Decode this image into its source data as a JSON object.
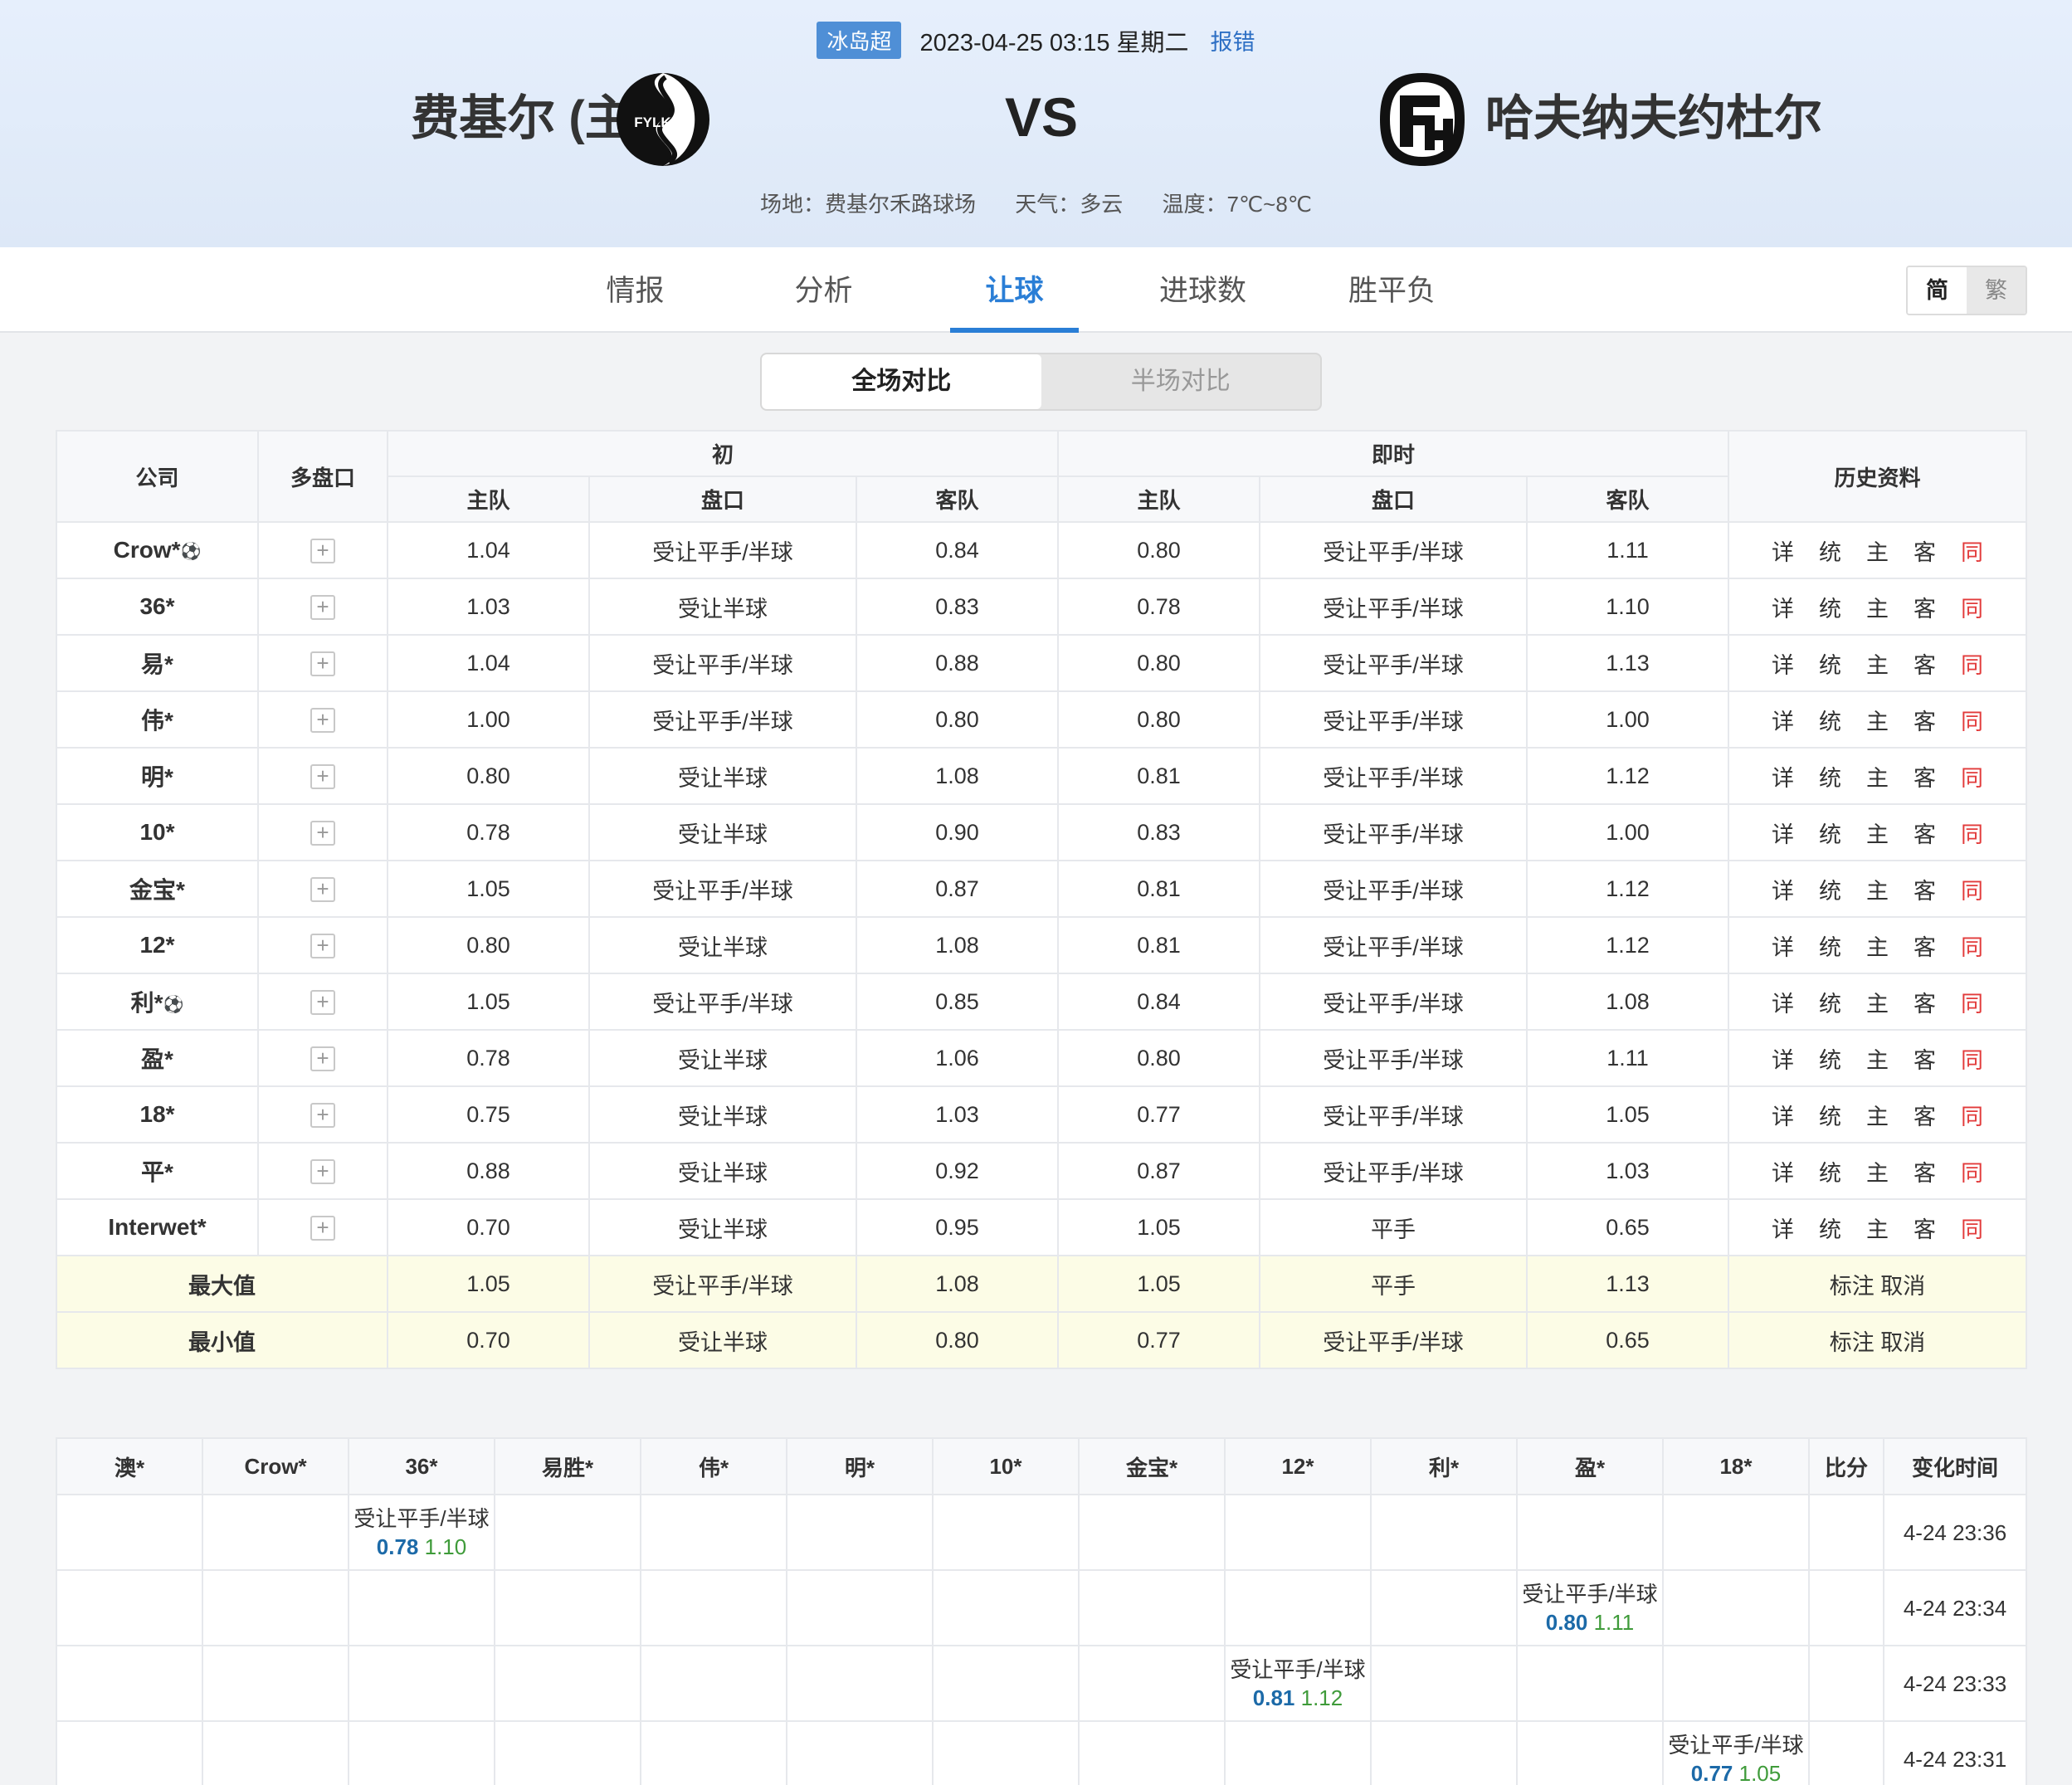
{
  "header": {
    "league": "冰岛超",
    "datetime": "2023-04-25 03:15 星期二",
    "report": "报错",
    "home_team": "费基尔 (主)",
    "away_team": "哈夫纳夫约杜尔",
    "vs": "VS",
    "venue": "场地：费基尔禾路球场",
    "weather": "天气：多云",
    "temperature": "温度：7℃~8℃",
    "home_logo_text": "FYLKIR"
  },
  "nav": {
    "tabs": [
      "情报",
      "分析",
      "让球",
      "进球数",
      "胜平负"
    ],
    "active": "让球",
    "lang_simplified": "简",
    "lang_traditional": "繁"
  },
  "toggle": {
    "full": "全场对比",
    "half": "半场对比"
  },
  "odds_table": {
    "headers": {
      "company": "公司",
      "multi": "多盘口",
      "initial": "初",
      "live": "即时",
      "history": "历史资料",
      "home": "主队",
      "handicap": "盘口",
      "away": "客队"
    },
    "history_links": [
      "详",
      "统",
      "主",
      "客",
      "同"
    ],
    "rows": [
      {
        "company": "Crow*",
        "ball": true,
        "i_home": "1.04",
        "i_hc": "受让平手/半球",
        "i_away": "0.84",
        "l_home": "0.80",
        "l_hc": "受让平手/半球",
        "l_away": "1.11"
      },
      {
        "company": "36*",
        "ball": false,
        "i_home": "1.03",
        "i_hc": "受让半球",
        "i_away": "0.83",
        "l_home": "0.78",
        "l_hc": "受让平手/半球",
        "l_away": "1.10"
      },
      {
        "company": "易*",
        "ball": false,
        "i_home": "1.04",
        "i_hc": "受让平手/半球",
        "i_away": "0.88",
        "l_home": "0.80",
        "l_hc": "受让平手/半球",
        "l_away": "1.13"
      },
      {
        "company": "伟*",
        "ball": false,
        "i_home": "1.00",
        "i_hc": "受让平手/半球",
        "i_away": "0.80",
        "l_home": "0.80",
        "l_hc": "受让平手/半球",
        "l_away": "1.00"
      },
      {
        "company": "明*",
        "ball": false,
        "i_home": "0.80",
        "i_hc": "受让半球",
        "i_away": "1.08",
        "l_home": "0.81",
        "l_hc": "受让平手/半球",
        "l_away": "1.12"
      },
      {
        "company": "10*",
        "ball": false,
        "i_home": "0.78",
        "i_hc": "受让半球",
        "i_away": "0.90",
        "l_home": "0.83",
        "l_hc": "受让平手/半球",
        "l_away": "1.00"
      },
      {
        "company": "金宝*",
        "ball": false,
        "i_home": "1.05",
        "i_hc": "受让平手/半球",
        "i_away": "0.87",
        "l_home": "0.81",
        "l_hc": "受让平手/半球",
        "l_away": "1.12"
      },
      {
        "company": "12*",
        "ball": false,
        "i_home": "0.80",
        "i_hc": "受让半球",
        "i_away": "1.08",
        "l_home": "0.81",
        "l_hc": "受让平手/半球",
        "l_away": "1.12"
      },
      {
        "company": "利*",
        "ball": true,
        "i_home": "1.05",
        "i_hc": "受让平手/半球",
        "i_away": "0.85",
        "l_home": "0.84",
        "l_hc": "受让平手/半球",
        "l_away": "1.08"
      },
      {
        "company": "盈*",
        "ball": false,
        "i_home": "0.78",
        "i_hc": "受让半球",
        "i_away": "1.06",
        "l_home": "0.80",
        "l_hc": "受让平手/半球",
        "l_away": "1.11"
      },
      {
        "company": "18*",
        "ball": false,
        "i_home": "0.75",
        "i_hc": "受让半球",
        "i_away": "1.03",
        "l_home": "0.77",
        "l_hc": "受让平手/半球",
        "l_away": "1.05"
      },
      {
        "company": "平*",
        "ball": false,
        "i_home": "0.88",
        "i_hc": "受让半球",
        "i_away": "0.92",
        "l_home": "0.87",
        "l_hc": "受让平手/半球",
        "l_away": "1.03"
      },
      {
        "company": "Interwet*",
        "ball": false,
        "i_home": "0.70",
        "i_hc": "受让半球",
        "i_away": "0.95",
        "l_home": "1.05",
        "l_hc": "平手",
        "l_away": "0.65"
      }
    ],
    "max": {
      "label": "最大值",
      "i_home": "1.05",
      "i_hc": "受让平手/半球",
      "i_away": "1.08",
      "l_home": "1.05",
      "l_hc": "平手",
      "l_away": "1.13",
      "action": "标注 取消"
    },
    "min": {
      "label": "最小值",
      "i_home": "0.70",
      "i_hc": "受让半球",
      "i_away": "0.80",
      "l_home": "0.77",
      "l_hc": "受让平手/半球",
      "l_away": "0.65",
      "action": "标注 取消"
    }
  },
  "changes_table": {
    "columns": [
      "澳*",
      "Crow*",
      "36*",
      "易胜*",
      "伟*",
      "明*",
      "10*",
      "金宝*",
      "12*",
      "利*",
      "盈*",
      "18*",
      "比分",
      "变化时间"
    ],
    "rows": [
      {
        "col": 2,
        "hc": "受让平手/半球",
        "home": "0.78",
        "away": "1.10",
        "time": "4-24 23:36"
      },
      {
        "col": 10,
        "hc": "受让平手/半球",
        "home": "0.80",
        "away": "1.11",
        "time": "4-24 23:34"
      },
      {
        "col": 8,
        "hc": "受让平手/半球",
        "home": "0.81",
        "away": "1.12",
        "time": "4-24 23:33"
      },
      {
        "col": 11,
        "hc": "受让平手/半球",
        "home": "0.77",
        "away": "1.05",
        "time": "4-24 23:31"
      }
    ]
  }
}
